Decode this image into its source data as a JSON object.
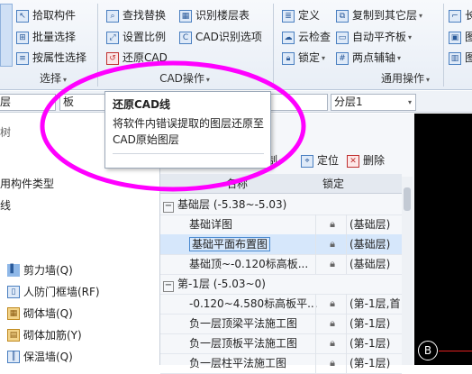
{
  "ribbon": {
    "group1": {
      "label": "选择",
      "items": [
        "拾取构件",
        "批量选择",
        "按属性选择"
      ]
    },
    "group2": {
      "label": "CAD操作",
      "items": [
        "查找替换",
        "识别楼层表",
        "设置比例",
        "CAD识别选项",
        "还原CAD"
      ]
    },
    "group3": {
      "label": "通用操作",
      "items": [
        "定义",
        "复制到其它层",
        "云检查",
        "自动平齐板",
        "锁定",
        "两点辅轴"
      ]
    },
    "cut_items": [
      "长",
      "图",
      "图"
    ]
  },
  "property_bar": {
    "floor_field": "层",
    "type_field": "板",
    "layer_field": "分层1"
  },
  "tooltip": {
    "title": "还原CAD线",
    "body": "将软件内错误提取的图层还原至CAD原始图层"
  },
  "left_panel": {
    "header_cut": "树",
    "items": [
      "用构件类型",
      "线",
      "剪力墙(Q)",
      "人防门框墙(RF)",
      "砌体墙(Q)",
      "砌体加筋(Y)",
      "保温墙(Q)"
    ]
  },
  "drawing_list": {
    "toolbar": {
      "copy_cut": "制",
      "locate": "定位",
      "delete": "删除"
    },
    "columns": [
      "名称",
      "锁定"
    ],
    "rows": [
      {
        "name": "基础层 (-5.38~-5.03)",
        "group": true
      },
      {
        "name": "基础详图",
        "value": "(基础层)"
      },
      {
        "name": "基础平面布置图",
        "value": "(基础层)",
        "selected": true
      },
      {
        "name": "基础顶~-0.120标高板...",
        "value": "(基础层)"
      },
      {
        "name": "第-1层 (-5.03~0)",
        "group": true
      },
      {
        "name": "-0.120~4.580标高板平...",
        "value": "(第-1层,首"
      },
      {
        "name": "负一层顶梁平法施工图",
        "value": "(第-1层)"
      },
      {
        "name": "负一层顶板平法施工图",
        "value": "(第-1层)"
      },
      {
        "name": "负一层柱平法施工图",
        "value": "(第-1层)"
      }
    ]
  },
  "canvas": {
    "axis_label": "B"
  },
  "colors": {
    "highlight_circle": "#ff00ff",
    "selected_row": "#d6e7fb",
    "canvas_bg": "#000000"
  }
}
